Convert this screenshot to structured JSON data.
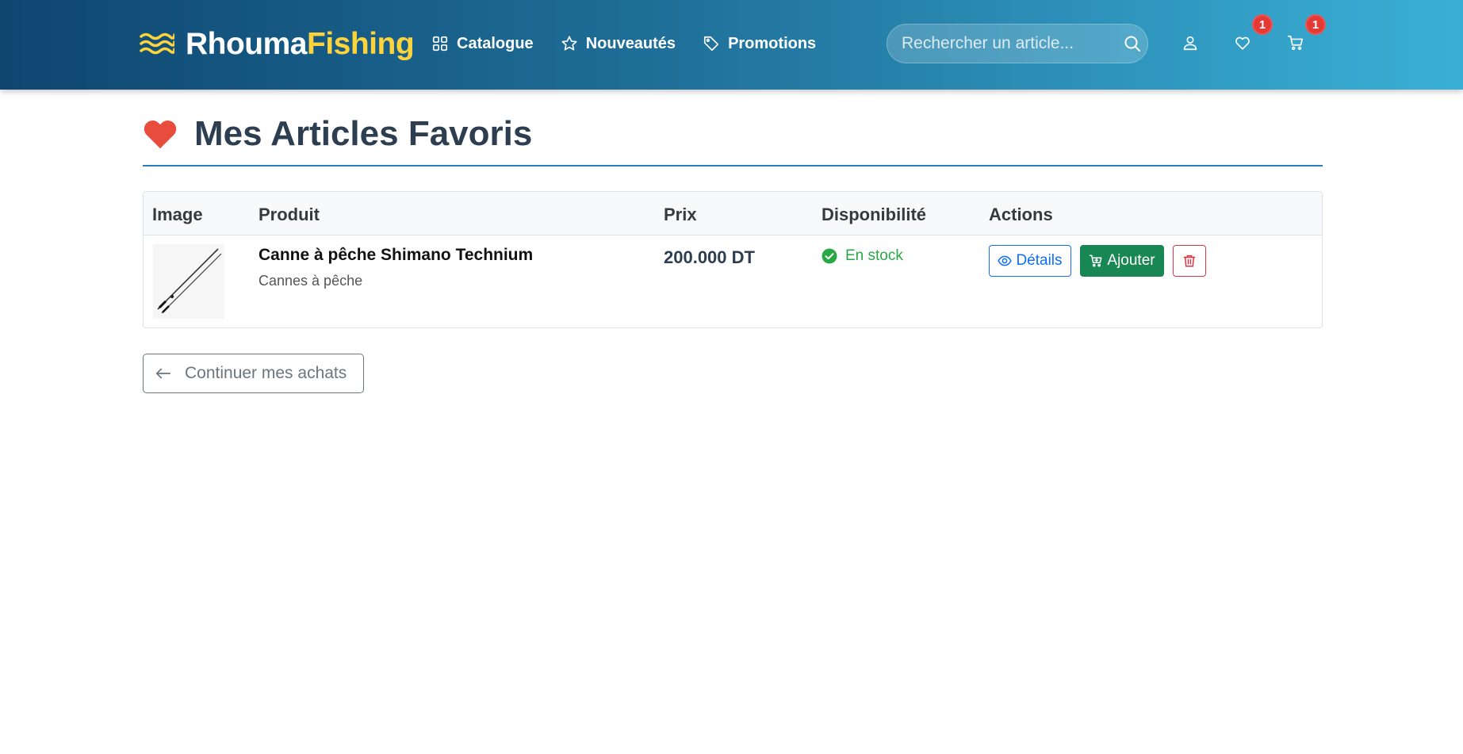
{
  "brand": {
    "part1": "Rhouma",
    "part2": "Fishing"
  },
  "nav": {
    "links": [
      {
        "label": "Catalogue",
        "icon": "grid-icon"
      },
      {
        "label": "Nouveautés",
        "icon": "star-icon"
      },
      {
        "label": "Promotions",
        "icon": "tag-icon"
      }
    ],
    "search_placeholder": "Rechercher un article...",
    "wishlist_count": "1",
    "cart_count": "1"
  },
  "page": {
    "title": "Mes Articles Favoris"
  },
  "table": {
    "headers": [
      "Image",
      "Produit",
      "Prix",
      "Disponibilité",
      "Actions"
    ],
    "rows": [
      {
        "name": "Canne à pêche Shimano Technium",
        "category": "Cannes à pêche",
        "price": "200.000 DT",
        "availability": "En stock",
        "details_label": "Détails",
        "add_label": "Ajouter"
      }
    ]
  },
  "continue_label": "Continuer mes achats",
  "colors": {
    "brand_accent": "#ffd43b",
    "in_stock": "#28a745",
    "add_button": "#198754",
    "details_button": "#0d6efd",
    "remove_button": "#dc3545",
    "badge": "#e53935"
  }
}
